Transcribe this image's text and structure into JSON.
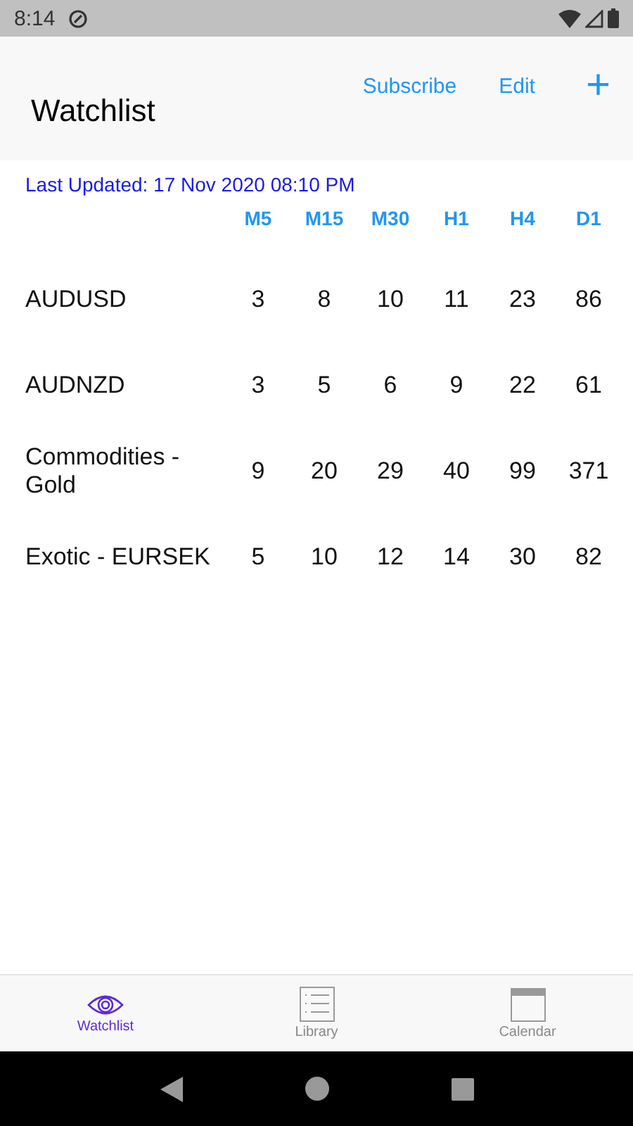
{
  "status_bar": {
    "time": "8:14"
  },
  "header": {
    "title": "Watchlist",
    "actions": [
      "Subscribe",
      "Edit"
    ],
    "add": "+"
  },
  "last_updated": "Last Updated: 17 Nov 2020 08:10 PM",
  "table": {
    "columns": [
      "M5",
      "M15",
      "M30",
      "H1",
      "H4",
      "D1"
    ],
    "rows": [
      {
        "name": "AUDUSD",
        "values": [
          "3",
          "8",
          "10",
          "11",
          "23",
          "86"
        ]
      },
      {
        "name": "AUDNZD",
        "values": [
          "3",
          "5",
          "6",
          "9",
          "22",
          "61"
        ]
      },
      {
        "name": "Commodities - Gold",
        "values": [
          "9",
          "20",
          "29",
          "40",
          "99",
          "371"
        ]
      },
      {
        "name": "Exotic - EURSEK",
        "values": [
          "5",
          "10",
          "12",
          "14",
          "30",
          "82"
        ]
      }
    ]
  },
  "tabs": [
    {
      "label": "Watchlist",
      "kind": "eye",
      "selected": true
    },
    {
      "label": "Library",
      "kind": "list",
      "selected": false
    },
    {
      "label": "Calendar",
      "kind": "calendar",
      "selected": false
    }
  ]
}
